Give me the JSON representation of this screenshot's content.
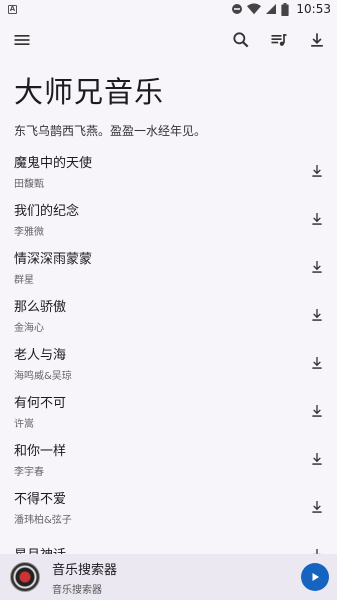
{
  "status_bar": {
    "time": "10:53",
    "notif_glyph": "A"
  },
  "toolbar": {
    "menu_icon": "hamburger-menu-icon",
    "search_icon": "search-icon",
    "queue_icon": "queue-music-icon",
    "download_icon": "download-icon"
  },
  "header": {
    "title": "大师兄音乐",
    "subtitle": "东飞乌鹊西飞燕。盈盈一水经年见。"
  },
  "songs": [
    {
      "title": "魔鬼中的天使",
      "artist": "田馥甄"
    },
    {
      "title": "我们的纪念",
      "artist": "李雅微"
    },
    {
      "title": "情深深雨蒙蒙",
      "artist": "群星"
    },
    {
      "title": "那么骄傲",
      "artist": "金海心"
    },
    {
      "title": "老人与海",
      "artist": "海鸣威&吴琼"
    },
    {
      "title": "有何不可",
      "artist": "许嵩"
    },
    {
      "title": "和你一样",
      "artist": "李宇春"
    },
    {
      "title": "不得不爱",
      "artist": "潘玮柏&弦子"
    },
    {
      "title": "星月神话",
      "artist": ""
    }
  ],
  "player": {
    "title": "音乐搜索器",
    "subtitle": "音乐搜索器",
    "accent": "#1565c0"
  }
}
